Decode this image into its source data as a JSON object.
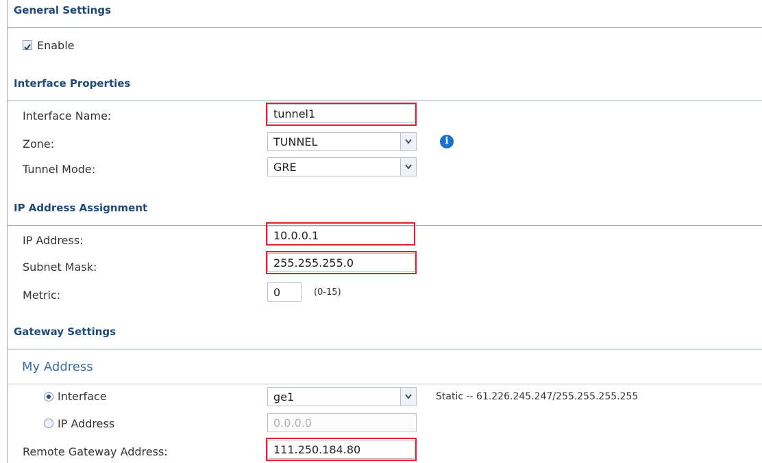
{
  "general": {
    "title": "General Settings",
    "enable_label": "Enable",
    "enable_checked": true
  },
  "interface": {
    "title": "Interface Properties",
    "name_label": "Interface Name:",
    "name_value": "tunnel1",
    "zone_label": "Zone:",
    "zone_value": "TUNNEL",
    "mode_label": "Tunnel Mode:",
    "mode_value": "GRE"
  },
  "ip": {
    "title": "IP Address Assignment",
    "address_label": "IP Address:",
    "address_value": "10.0.0.1",
    "mask_label": "Subnet Mask:",
    "mask_value": "255.255.255.0",
    "metric_label": "Metric:",
    "metric_value": "0",
    "metric_hint": "(0-15)"
  },
  "gateway": {
    "title": "Gateway Settings",
    "my_address_title": "My Address",
    "interface_label": "Interface",
    "interface_value": "ge1",
    "interface_status": "Static -- 61.226.245.247/255.255.255.255",
    "ip_label": "IP Address",
    "ip_value": "0.0.0.0",
    "remote_label": "Remote Gateway Address:",
    "remote_value": "111.250.184.80"
  },
  "colors": {
    "section_title": "#1e4a7a",
    "highlight": "#e0202a",
    "info": "#1a73c8"
  },
  "icons": [
    "checkbox-checked-icon",
    "info-icon",
    "dropdown-arrow-icon",
    "radio-selected-icon",
    "radio-unselected-icon"
  ]
}
